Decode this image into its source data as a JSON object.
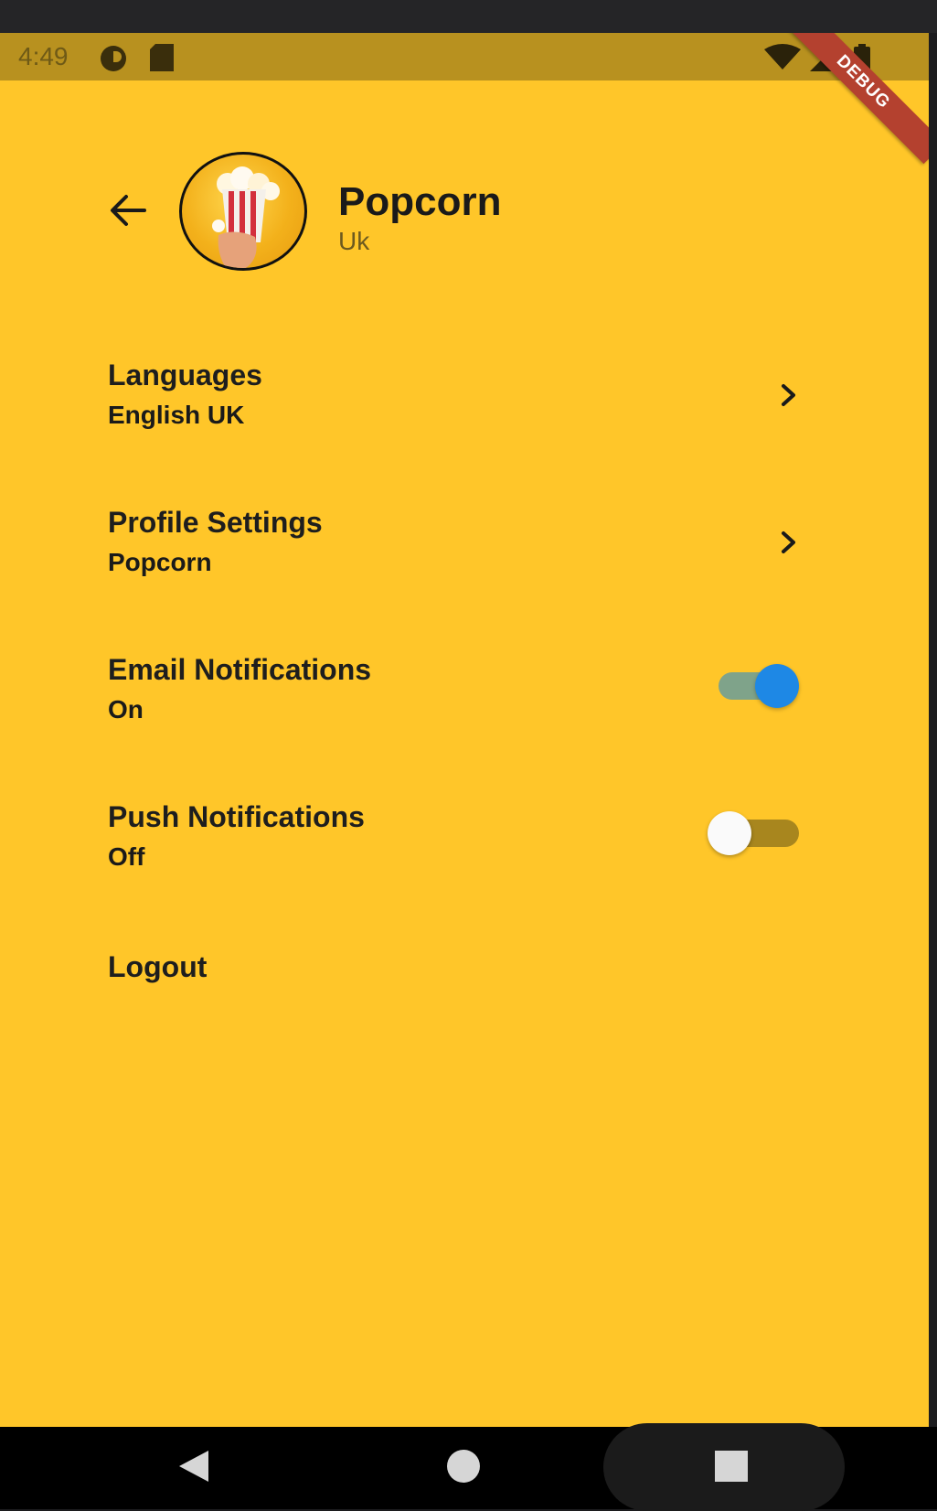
{
  "statusbar": {
    "time": "4:49",
    "icons": [
      "media-icon",
      "sd-card-icon",
      "wifi-icon",
      "signal-icon",
      "battery-icon"
    ],
    "debug_banner": "DEBUG"
  },
  "header": {
    "back_icon": "arrow-left-icon",
    "title": "Popcorn",
    "subtitle": "Uk"
  },
  "settings": [
    {
      "title": "Languages",
      "subtitle": "English UK",
      "control": "chevron-right-icon"
    },
    {
      "title": "Profile Settings",
      "subtitle": "Popcorn",
      "control": "chevron-right-icon"
    },
    {
      "title": "Email Notifications",
      "subtitle": "On",
      "control": "switch",
      "enabled": true
    },
    {
      "title": "Push Notifications",
      "subtitle": "Off",
      "control": "switch",
      "enabled": false
    }
  ],
  "logout_label": "Logout",
  "navbar": [
    "back-icon",
    "home-icon",
    "recents-icon"
  ],
  "colors": {
    "background": "#FFC629",
    "statusbar": "#B8911F",
    "switch_on": "#1E88E5",
    "switch_off_thumb": "#FAFAFA",
    "debug_banner": "#B4412F"
  }
}
